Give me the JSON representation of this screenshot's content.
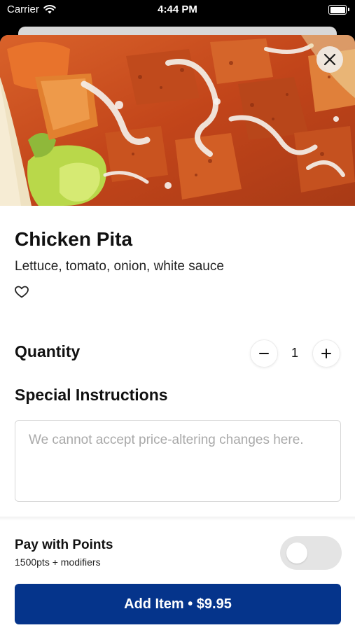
{
  "status_bar": {
    "carrier": "Carrier",
    "time": "4:44 PM"
  },
  "item": {
    "name": "Chicken Pita",
    "description": "Lettuce, tomato, onion, white sauce",
    "image_icon": "food-photo"
  },
  "quantity": {
    "label": "Quantity",
    "value": "1",
    "decrement_icon": "minus-icon",
    "increment_icon": "plus-icon"
  },
  "special_instructions": {
    "label": "Special Instructions",
    "placeholder": "We cannot accept price-altering changes here.",
    "value": ""
  },
  "points": {
    "title": "Pay with Points",
    "subtitle": "1500pts + modifiers",
    "toggle_on": false
  },
  "add_button": {
    "label": "Add Item • $9.95"
  },
  "colors": {
    "brand_primary": "#05348b",
    "toggle_off": "#e4e4e4",
    "text_primary": "#111111",
    "placeholder": "#a9a9a9"
  }
}
